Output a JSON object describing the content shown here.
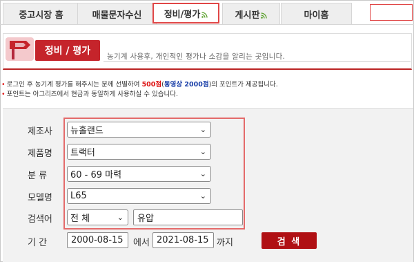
{
  "tabs": [
    {
      "label": "중고시장 홈",
      "rss": false
    },
    {
      "label": "매물문자수신",
      "rss": false
    },
    {
      "label": "정비/평가",
      "rss": true
    },
    {
      "label": "게시판",
      "rss": true
    },
    {
      "label": "마이홈",
      "rss": false
    }
  ],
  "header": {
    "title": "정비 / 평가",
    "description": "농기계 사용후, 개인적인 평가나 소감을 알리는 곳입니다."
  },
  "notes": {
    "line1_a": "로그인 후 농기계 평가를 해주시는 분께 선별하여 ",
    "line1_points": "500점",
    "line1_b": "(",
    "line1_video": "동영상 2000점",
    "line1_c": ")의 포인트가 제공됩니다.",
    "line2": "포인트는 아그리즈에서 현금과 동일하게 사용하실 수 있습니다."
  },
  "form": {
    "maker_label": "제조사",
    "maker_value": "뉴홀랜드",
    "product_label": "제품명",
    "product_value": "트랙터",
    "class_label": "분 류",
    "class_value": "60 - 69 마력",
    "model_label": "모델명",
    "model_value": "L65",
    "keyword_label": "검색어",
    "keyword_scope": "전 체",
    "keyword_value": "유압",
    "period_label": "기 간",
    "date_from": "2000-08-15",
    "between_text": "에서",
    "date_to": "2021-08-15",
    "until_text": "까지",
    "search_button": "검 색"
  },
  "colors": {
    "accent_red": "#c5242b",
    "highlight_outline": "#e46a6a",
    "button_red": "#b01014",
    "rss_green": "#5aa02c"
  }
}
